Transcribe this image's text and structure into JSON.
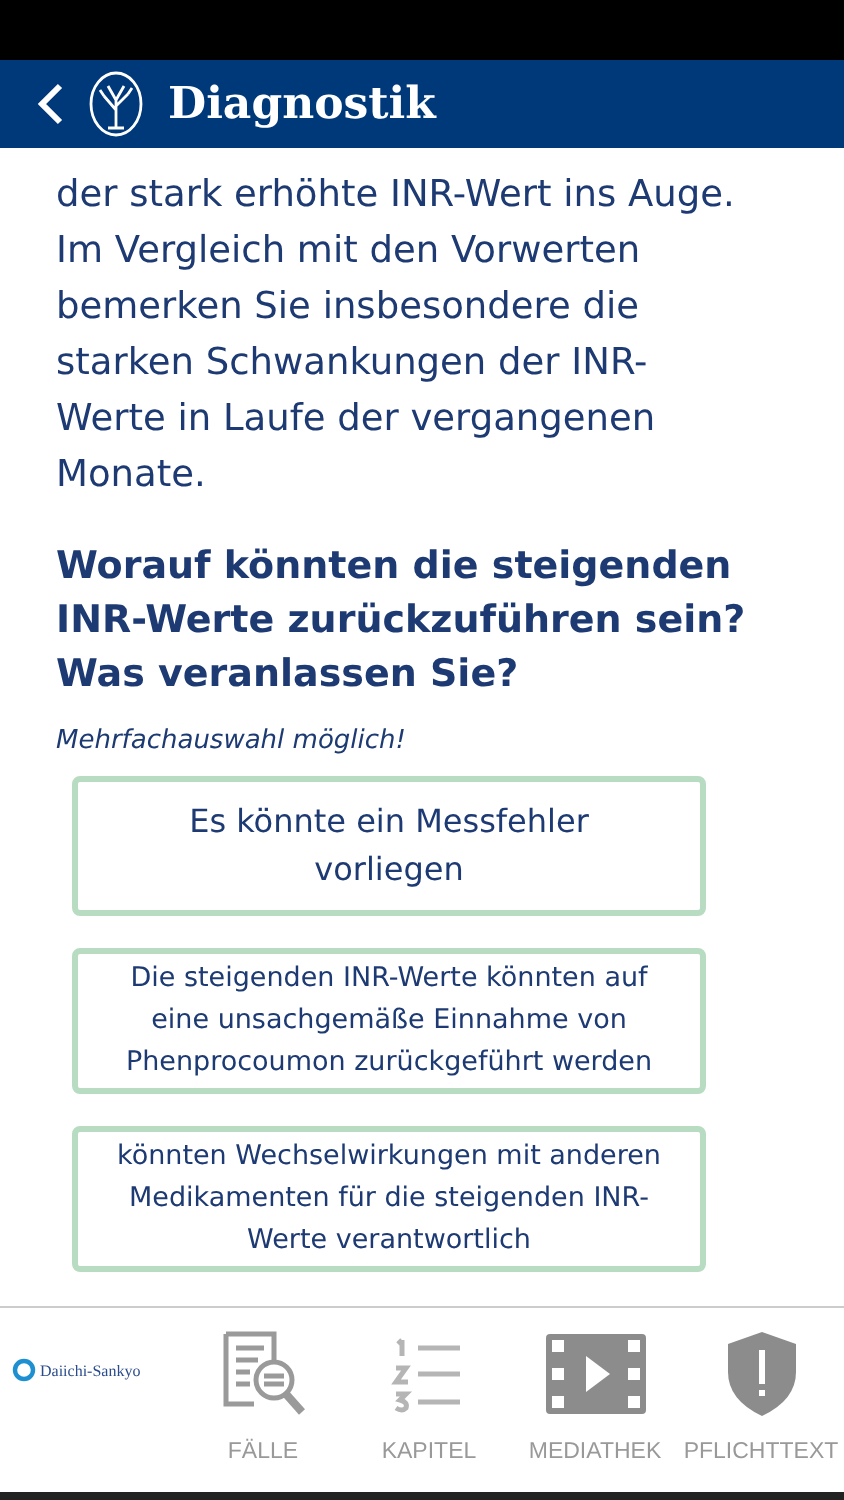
{
  "header": {
    "title": "Diagnostik"
  },
  "case_text": [
    "der stark erhöhte INR-Wert ins Auge.",
    "Im Vergleich mit den Vorwerten",
    "bemerken Sie insbesondere die",
    "starken Schwankungen der INR-",
    "Werte in Laufe der vergangenen",
    "Monate."
  ],
  "question": "Worauf könnten die steigenden INR-Werte zurückzuführen sein? Was veranlassen Sie?",
  "hint": "Mehrfachauswahl möglich!",
  "options": [
    {
      "text": "Es könnte ein Messfehler vorliegen",
      "kind": "large"
    },
    {
      "text": "Die steigenden INR-Werte könnten auf eine unsachgemäße Einnahme von Phenprocoumon zurückgeführt werden",
      "kind": "small"
    },
    {
      "text": "könnten Wechselwirkungen mit anderen Medikamenten für die steigenden INR-Werte verantwortlich",
      "kind": "small"
    }
  ],
  "tab_bar": {
    "brand": "Daiichi-Sankyo",
    "tabs": [
      {
        "label": "FÄLLE",
        "kind": "cases"
      },
      {
        "label": "KAPITEL",
        "kind": "chapters"
      },
      {
        "label": "MEDIATHEK",
        "kind": "media"
      },
      {
        "label": "PFLICHTTEXT",
        "kind": "legal"
      }
    ]
  }
}
